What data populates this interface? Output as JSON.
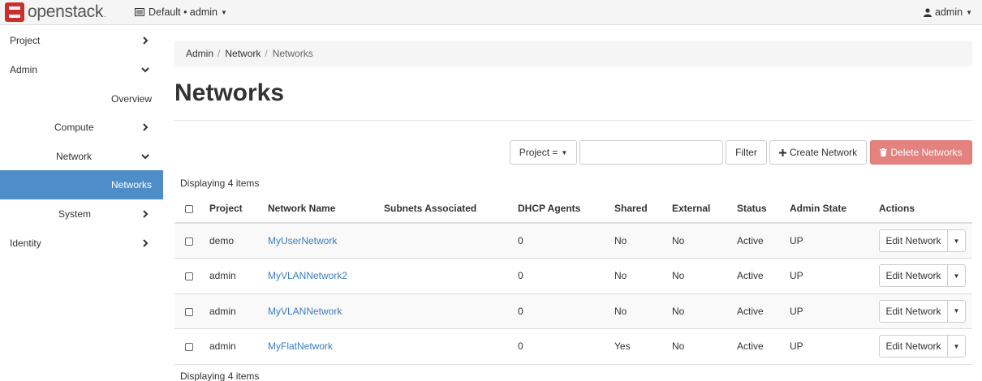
{
  "navbar": {
    "brand": "openstack",
    "brand_suffix": ".",
    "context": "Default • admin",
    "user": "admin"
  },
  "sidebar": {
    "items": [
      {
        "label": "Project"
      },
      {
        "label": "Admin"
      },
      {
        "label": "Overview"
      },
      {
        "label": "Compute"
      },
      {
        "label": "Network"
      },
      {
        "label": "Networks"
      },
      {
        "label": "System"
      },
      {
        "label": "Identity"
      }
    ]
  },
  "breadcrumb": [
    "Admin",
    "Network",
    "Networks"
  ],
  "page": {
    "title": "Networks"
  },
  "toolbar": {
    "filter_field": "Project =",
    "filter_value": "",
    "filter_label": "Filter",
    "create_label": "Create Network",
    "delete_label": "Delete Networks"
  },
  "table": {
    "count_label": "Displaying 4 items",
    "columns": [
      "Project",
      "Network Name",
      "Subnets Associated",
      "DHCP Agents",
      "Shared",
      "External",
      "Status",
      "Admin State",
      "Actions"
    ],
    "rows": [
      {
        "project": "demo",
        "name": "MyUserNetwork",
        "subnets": "",
        "dhcp": "0",
        "shared": "No",
        "external": "No",
        "status": "Active",
        "admin_state": "UP",
        "action": "Edit Network"
      },
      {
        "project": "admin",
        "name": "MyVLANNetwork2",
        "subnets": "",
        "dhcp": "0",
        "shared": "No",
        "external": "No",
        "status": "Active",
        "admin_state": "UP",
        "action": "Edit Network"
      },
      {
        "project": "admin",
        "name": "MyVLANNetwork",
        "subnets": "",
        "dhcp": "0",
        "shared": "No",
        "external": "No",
        "status": "Active",
        "admin_state": "UP",
        "action": "Edit Network"
      },
      {
        "project": "admin",
        "name": "MyFlatNetwork",
        "subnets": "",
        "dhcp": "0",
        "shared": "Yes",
        "external": "No",
        "status": "Active",
        "admin_state": "UP",
        "action": "Edit Network"
      }
    ]
  },
  "colors": {
    "accent": "#4f8dc8",
    "link": "#3b7cbf",
    "danger": "#d9534f"
  }
}
